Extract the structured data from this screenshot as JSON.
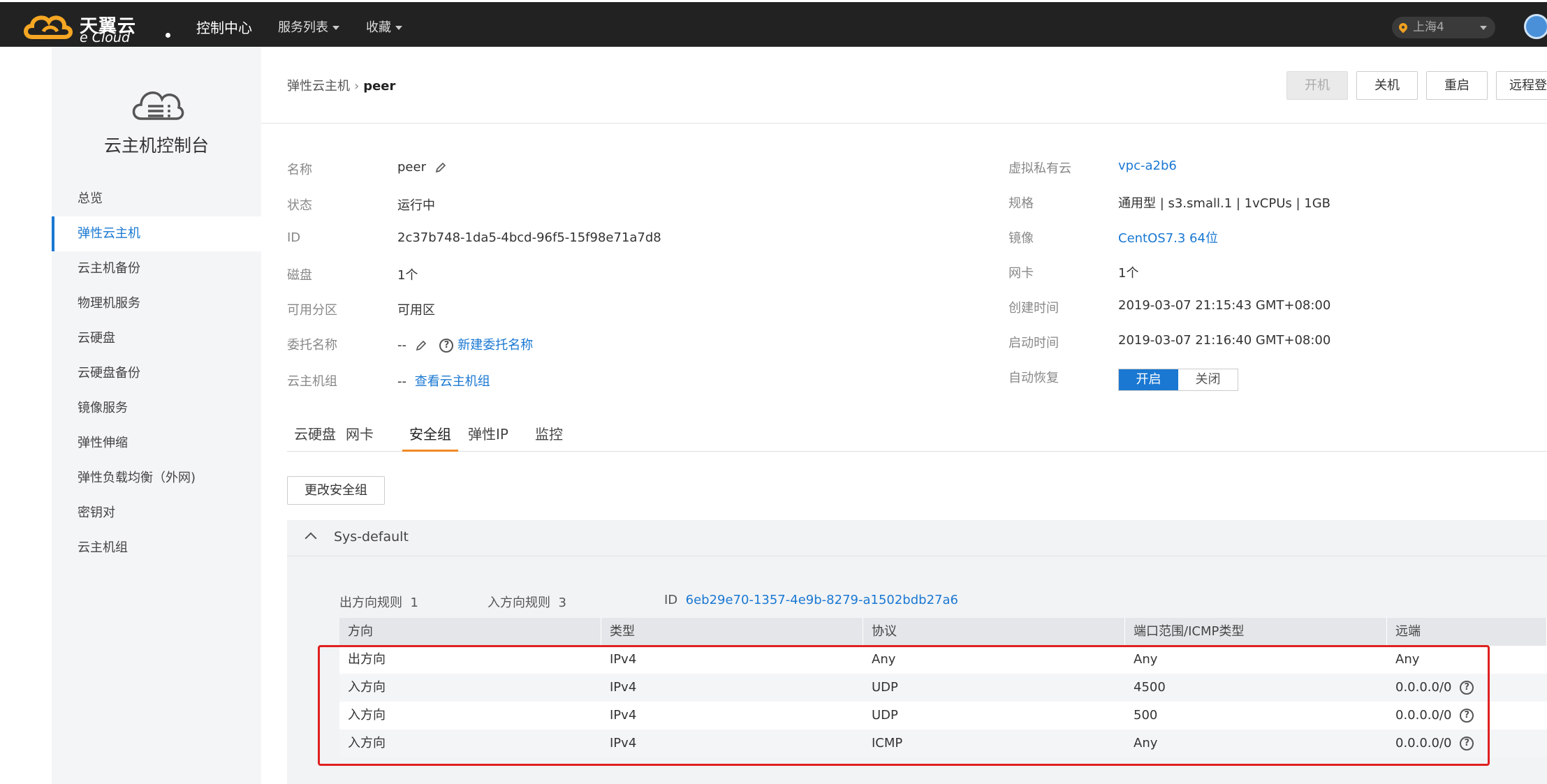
{
  "topbar": {
    "logo_cn": "天翼云",
    "logo_en": "e Cloud",
    "nav": [
      "控制中心",
      "服务列表",
      "收藏"
    ],
    "region": "上海4"
  },
  "sidebar": {
    "title": "云主机控制台",
    "items": [
      "总览",
      "弹性云主机",
      "云主机备份",
      "物理机服务",
      "云硬盘",
      "云硬盘备份",
      "镜像服务",
      "弹性伸缩",
      "弹性负载均衡（外网)",
      "密钥对",
      "云主机组"
    ],
    "active_index": 1
  },
  "breadcrumb": {
    "parent": "弹性云主机",
    "sep": "›",
    "current": "peer"
  },
  "actions": {
    "start": "开机",
    "stop": "关机",
    "restart": "重启",
    "remote": "远程登"
  },
  "details_left": [
    {
      "label": "名称",
      "value": "peer"
    },
    {
      "label": "状态",
      "value": "运行中"
    },
    {
      "label": "ID",
      "value": "2c37b748-1da5-4bcd-96f5-15f98e71a7d8"
    },
    {
      "label": "磁盘",
      "value": "1个"
    },
    {
      "label": "可用分区",
      "value": "可用区"
    },
    {
      "label": "委托名称",
      "value": "--",
      "link": "新建委托名称"
    },
    {
      "label": "云主机组",
      "value": "--",
      "link": "查看云主机组"
    }
  ],
  "details_right": [
    {
      "label": "虚拟私有云",
      "value": "vpc-a2b6"
    },
    {
      "label": "规格",
      "value": "通用型 | s3.small.1 | 1vCPUs | 1GB"
    },
    {
      "label": "镜像",
      "value": "CentOS7.3 64位"
    },
    {
      "label": "网卡",
      "value": "1个"
    },
    {
      "label": "创建时间",
      "value": "2019-03-07 21:15:43 GMT+08:00"
    },
    {
      "label": "启动时间",
      "value": "2019-03-07 21:16:40 GMT+08:00"
    },
    {
      "label": "自动恢复",
      "on": "开启",
      "off": "关闭"
    }
  ],
  "tabs": [
    "云硬盘",
    "网卡",
    "安全组",
    "弹性IP",
    "监控"
  ],
  "active_tab": 2,
  "change_sg_button": "更改安全组",
  "security_group": {
    "name": "Sys-default",
    "outbound_label": "出方向规则",
    "outbound_count": "1",
    "inbound_label": "入方向规则",
    "inbound_count": "3",
    "id_label": "ID",
    "id_value": "6eb29e70-1357-4e9b-8279-a1502bdb27a6",
    "columns": [
      "方向",
      "类型",
      "协议",
      "端口范围/ICMP类型",
      "远端"
    ],
    "rows": [
      [
        "出方向",
        "IPv4",
        "Any",
        "Any",
        "Any"
      ],
      [
        "入方向",
        "IPv4",
        "UDP",
        "4500",
        "0.0.0.0/0"
      ],
      [
        "入方向",
        "IPv4",
        "UDP",
        "500",
        "0.0.0.0/0"
      ],
      [
        "入方向",
        "IPv4",
        "ICMP",
        "Any",
        "0.0.0.0/0"
      ]
    ]
  },
  "colors": {
    "accent": "#1a78d2",
    "tab_underline": "#f08a24",
    "highlight": "#e02020"
  }
}
